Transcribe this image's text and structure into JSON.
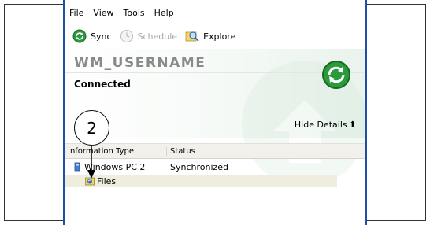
{
  "menu": [
    "File",
    "View",
    "Tools",
    "Help"
  ],
  "toolbar": {
    "sync_label": "Sync",
    "schedule_label": "Schedule",
    "explore_label": "Explore"
  },
  "device": {
    "username": "WM_USERNAME",
    "status": "Connected",
    "hide_details": "Hide Details"
  },
  "table": {
    "headers": [
      "Information Type",
      "Status"
    ],
    "rows": [
      {
        "name": "Windows PC 2",
        "status": "Synchronized"
      },
      {
        "name": "Files",
        "status": ""
      }
    ]
  },
  "callout": {
    "number": "2"
  },
  "colors": {
    "accent": "#1e4ea8",
    "sync_green": "#2a9a3c",
    "selected_row": "#eeedde"
  }
}
